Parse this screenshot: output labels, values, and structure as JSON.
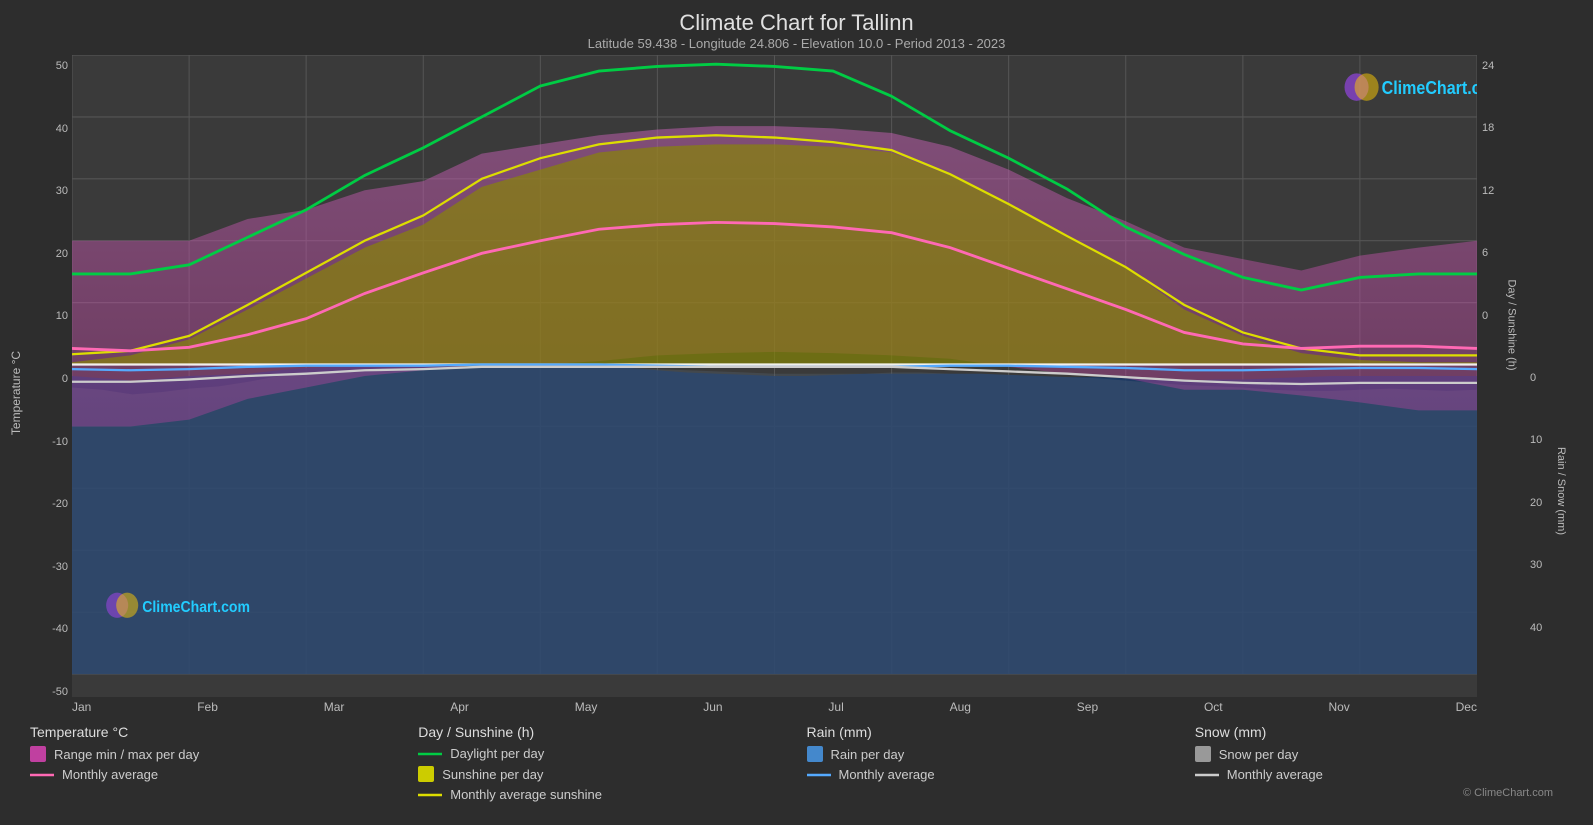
{
  "page": {
    "title": "Climate Chart for Tallinn",
    "subtitle": "Latitude 59.438 - Longitude 24.806 - Elevation 10.0 - Period 2013 - 2023",
    "copyright": "© ClimeChart.com",
    "watermark": "ClimeChart.com"
  },
  "y_axis_left": {
    "label": "Temperature °C",
    "values": [
      "50",
      "40",
      "30",
      "20",
      "10",
      "0",
      "-10",
      "-20",
      "-30",
      "-40",
      "-50"
    ]
  },
  "y_axis_right_sunshine": {
    "label": "Day / Sunshine (h)",
    "values": [
      "24",
      "18",
      "12",
      "6",
      "0"
    ]
  },
  "y_axis_right_rain": {
    "label": "Rain / Snow (mm)",
    "values": [
      "0",
      "10",
      "20",
      "30",
      "40"
    ]
  },
  "x_axis": {
    "months": [
      "Jan",
      "Feb",
      "Mar",
      "Apr",
      "May",
      "Jun",
      "Jul",
      "Aug",
      "Sep",
      "Oct",
      "Nov",
      "Dec"
    ]
  },
  "legend": {
    "temperature": {
      "title": "Temperature °C",
      "items": [
        {
          "type": "rect",
          "color": "#c040a0",
          "label": "Range min / max per day"
        },
        {
          "type": "line",
          "color": "#ff69b4",
          "label": "Monthly average"
        }
      ]
    },
    "sunshine": {
      "title": "Day / Sunshine (h)",
      "items": [
        {
          "type": "line",
          "color": "#00cc44",
          "label": "Daylight per day"
        },
        {
          "type": "rect",
          "color": "#cccc00",
          "label": "Sunshine per day"
        },
        {
          "type": "line",
          "color": "#dddd00",
          "label": "Monthly average sunshine"
        }
      ]
    },
    "rain": {
      "title": "Rain (mm)",
      "items": [
        {
          "type": "rect",
          "color": "#4488cc",
          "label": "Rain per day"
        },
        {
          "type": "line",
          "color": "#55aaff",
          "label": "Monthly average"
        }
      ]
    },
    "snow": {
      "title": "Snow (mm)",
      "items": [
        {
          "type": "rect",
          "color": "#aaaaaa",
          "label": "Snow per day"
        },
        {
          "type": "line",
          "color": "#cccccc",
          "label": "Monthly average"
        }
      ]
    }
  },
  "colors": {
    "background": "#2d2d2d",
    "chart_bg": "#3a3a3a",
    "grid": "#555555",
    "temp_range": "#c040a0",
    "temp_avg": "#ff69b4",
    "daylight": "#00cc44",
    "sunshine": "#cccc00",
    "sunshine_avg": "#dddd00",
    "rain": "#4488cc",
    "rain_avg": "#55aaff",
    "snow": "#aaaaaa",
    "snow_avg": "#cccccc",
    "zero_line": "#ffffff"
  }
}
